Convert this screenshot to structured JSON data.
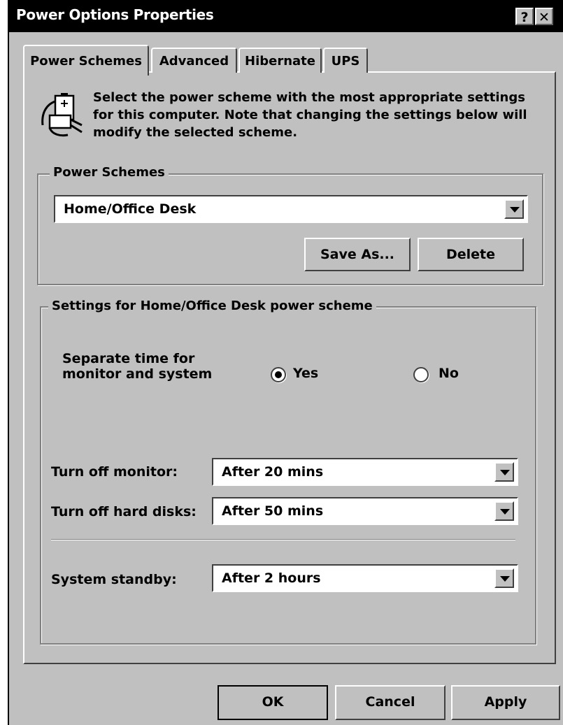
{
  "window": {
    "title": "Power Options Properties",
    "help_label": "?",
    "close_label": "✕"
  },
  "tabs": [
    {
      "label": "Power Schemes",
      "active": true
    },
    {
      "label": "Advanced"
    },
    {
      "label": "Hibernate"
    },
    {
      "label": "UPS"
    }
  ],
  "intro": {
    "icon": "power-plug-battery-icon",
    "text": "Select the power scheme with the most appropriate settings for this computer. Note that changing the settings below will modify the selected scheme."
  },
  "power_schemes": {
    "legend": "Power Schemes",
    "selected": "Home/Office Desk",
    "save_as_label": "Save As...",
    "delete_label": "Delete"
  },
  "settings": {
    "legend": "Settings for Home/Office Desk power scheme",
    "separate_time_label_line1": "Separate time for",
    "separate_time_label_line2": "monitor and system",
    "yes_label": "Yes",
    "no_label": "No",
    "yes_selected": true,
    "monitor_label": "Turn off monitor:",
    "monitor_value": "After 20 mins",
    "hard_disks_label": "Turn off hard disks:",
    "hard_disks_value": "After 50 mins",
    "standby_label": "System standby:",
    "standby_value": "After 2 hours"
  },
  "footer": {
    "ok_label": "OK",
    "cancel_label": "Cancel",
    "apply_label": "Apply"
  }
}
